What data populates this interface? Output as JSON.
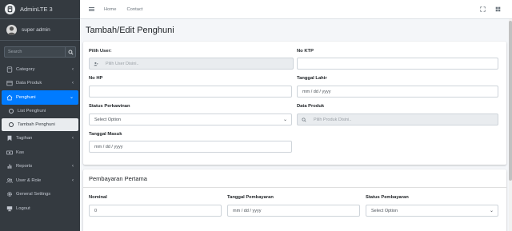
{
  "brand": {
    "name": "AdminLTE 3"
  },
  "user": {
    "name": "super admin"
  },
  "sidebar": {
    "search_placeholder": "Search",
    "items": [
      {
        "label": "Category",
        "icon": "tag-icon",
        "chevron": "‹"
      },
      {
        "label": "Data Produk",
        "icon": "box-icon",
        "chevron": "‹"
      },
      {
        "label": "Penghuni",
        "icon": "home-icon",
        "chevron": "⌄",
        "active": true
      },
      {
        "label": "List Penghuni",
        "icon": "circle-icon"
      },
      {
        "label": "Tambah Penghuni",
        "icon": "circle-icon",
        "current": true
      },
      {
        "label": "Tagihan",
        "icon": "bookmark-icon",
        "chevron": "‹"
      },
      {
        "label": "Kas",
        "icon": "money-icon"
      },
      {
        "label": "Reports",
        "icon": "chart-icon",
        "chevron": "‹"
      },
      {
        "label": "User & Role",
        "icon": "users-icon",
        "chevron": "‹"
      },
      {
        "label": "General Settings",
        "icon": "gear-icon"
      },
      {
        "label": "Logout",
        "icon": "logout-icon"
      }
    ]
  },
  "topbar": {
    "home": "Home",
    "contact": "Contact"
  },
  "page": {
    "title": "Tambah/Edit Penghuni"
  },
  "form": {
    "pilih_user": {
      "label": "Pilih User:",
      "placeholder": "Pilih User Disini.."
    },
    "no_ktp": {
      "label": "No KTP",
      "value": ""
    },
    "no_hp": {
      "label": "No HP",
      "value": ""
    },
    "tanggal_lahir": {
      "label": "Tanggal Lahir",
      "placeholder": "mm / dd / yyyy"
    },
    "status_perkawinan": {
      "label": "Status Perkawinan",
      "value": "Select Option"
    },
    "data_produk": {
      "label": "Data Produk",
      "placeholder": "Pilih Produk Disini.."
    },
    "tanggal_masuk": {
      "label": "Tanggal Masuk",
      "placeholder": "mm / dd / yyyy"
    }
  },
  "payment": {
    "title": "Pembayaran Pertama",
    "nominal": {
      "label": "Nominal",
      "value": "0"
    },
    "tanggal": {
      "label": "Tanggal Pembayaran",
      "placeholder": "mm / dd / yyyy"
    },
    "status": {
      "label": "Status Pembayaran",
      "value": "Select Option"
    }
  },
  "colors": {
    "sidebar_bg": "#343a40",
    "accent": "#007bff",
    "content_bg": "#f4f6f9"
  }
}
